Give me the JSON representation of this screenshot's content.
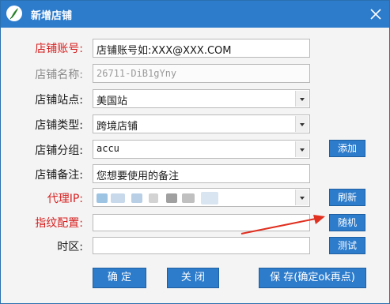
{
  "window": {
    "title": "新增店铺"
  },
  "fields": {
    "account": {
      "label": "店铺账号:",
      "value": "店铺账号如:XXX@XXX.COM"
    },
    "name": {
      "label": "店铺名称:",
      "value": "26711-DiB1gYny"
    },
    "site": {
      "label": "店铺站点:",
      "value": "美国站"
    },
    "type": {
      "label": "店铺类型:",
      "value": "跨境店铺"
    },
    "group": {
      "label": "店铺分组:",
      "value": "accu",
      "add_button": "添加"
    },
    "note": {
      "label": "店铺备注:",
      "value": "您想要使用的备注"
    },
    "proxy": {
      "label": "代理IP:",
      "refresh_button": "刷新"
    },
    "fingerprint": {
      "label": "指纹配置:",
      "value": "",
      "random_button": "随机"
    },
    "timezone": {
      "label": "时区:",
      "value": "",
      "test_button": "测试"
    }
  },
  "actions": {
    "confirm": "确 定",
    "close": "关 闭",
    "save": "保 存(确定ok再点)"
  },
  "colors": {
    "titlebar": "#2d7ccc",
    "button": "#2d7ccc",
    "required_label": "#d81e1e",
    "annotation_arrow": "#e03020"
  }
}
